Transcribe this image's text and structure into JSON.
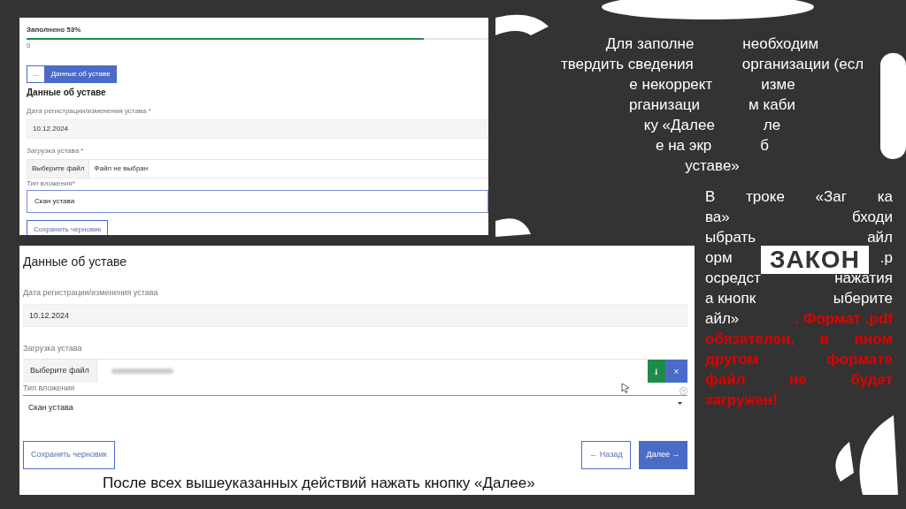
{
  "small_form": {
    "progress_label": "Заполнено 53%",
    "progress": {
      "level": 0.86
    },
    "progress_note": "0",
    "breadcrumbs": [
      {
        "label": "...",
        "selected": false
      },
      {
        "label": "Данные об уставе",
        "selected": true
      }
    ],
    "heading": "Данные об уставе",
    "date_label": "Дата регистрации/изменения устава *",
    "date_value": "10.12.2024",
    "upload_label": "Загрузка устава *",
    "choose_file": "Выберите файл",
    "file_status": "Файл не выбран",
    "type_label": "Тип вложения*",
    "type_value": "Скан устава",
    "save_draft": "Сохранить черновик"
  },
  "form": {
    "heading": "Данные об уставе",
    "date_label": "Дата регистрации/изменения устава",
    "date_value": "10.12.2024",
    "upload_label": "Загрузка устава",
    "choose_file": "Выберите файл",
    "download": "⭳",
    "remove": "×",
    "type_label": "Тип вложения",
    "help": "?",
    "type_value": "Скан устава",
    "save_draft": "Сохранить черновик",
    "back": "← Назад",
    "next": "Далее →",
    "caption": "После всех вышеуказанных действий нажать кнопку «Далее»"
  },
  "instructions": {
    "para_1": [
      [
        "Для заполне",
        "необходим"
      ],
      [
        "твердить сведения",
        "организации (есл"
      ],
      [
        "е некоррект",
        "изме"
      ],
      [
        "рганизаци",
        "м каби"
      ],
      [
        "ку «Далее",
        "ле"
      ],
      [
        "е на экр",
        "б"
      ],
      [
        "уставе»"
      ]
    ],
    "sign": "ЗАКОН",
    "para_2": [
      [
        {
          "text": "В",
          "kind": "plain"
        },
        {
          "text": "троке",
          "kind": "plain"
        },
        {
          "text": "«Заг",
          "kind": "plain"
        },
        {
          "text": "ка",
          "kind": "plain"
        }
      ],
      [
        {
          "text": "ва»",
          "kind": "plain"
        },
        {
          "text": "бходи",
          "kind": "plain"
        }
      ],
      [
        {
          "text": "ыбрать",
          "kind": "plain"
        },
        {
          "text": "айл",
          "kind": "plain"
        }
      ],
      [
        {
          "text": "орм",
          "kind": "plain"
        },
        {
          "text": ".p",
          "kind": "plain"
        }
      ],
      [
        {
          "text": "осредст",
          "kind": "plain"
        },
        {
          "text": "нажатия",
          "kind": "plain"
        }
      ],
      [
        {
          "text": "а кнопк",
          "kind": "plain"
        },
        {
          "text": "ыберите",
          "kind": "plain"
        }
      ],
      [
        {
          "text": "айл»",
          "kind": "plain"
        },
        {
          "text": ". Формат .pdf",
          "kind": "warning"
        }
      ],
      [
        {
          "text": "обязателен, в ином",
          "kind": "warning"
        }
      ],
      [
        {
          "text": "другом формате",
          "kind": "warning"
        }
      ],
      [
        {
          "text": "файл не будет",
          "kind": "warning"
        }
      ],
      [
        {
          "text": "загружен!",
          "kind": "warning"
        }
      ]
    ]
  }
}
